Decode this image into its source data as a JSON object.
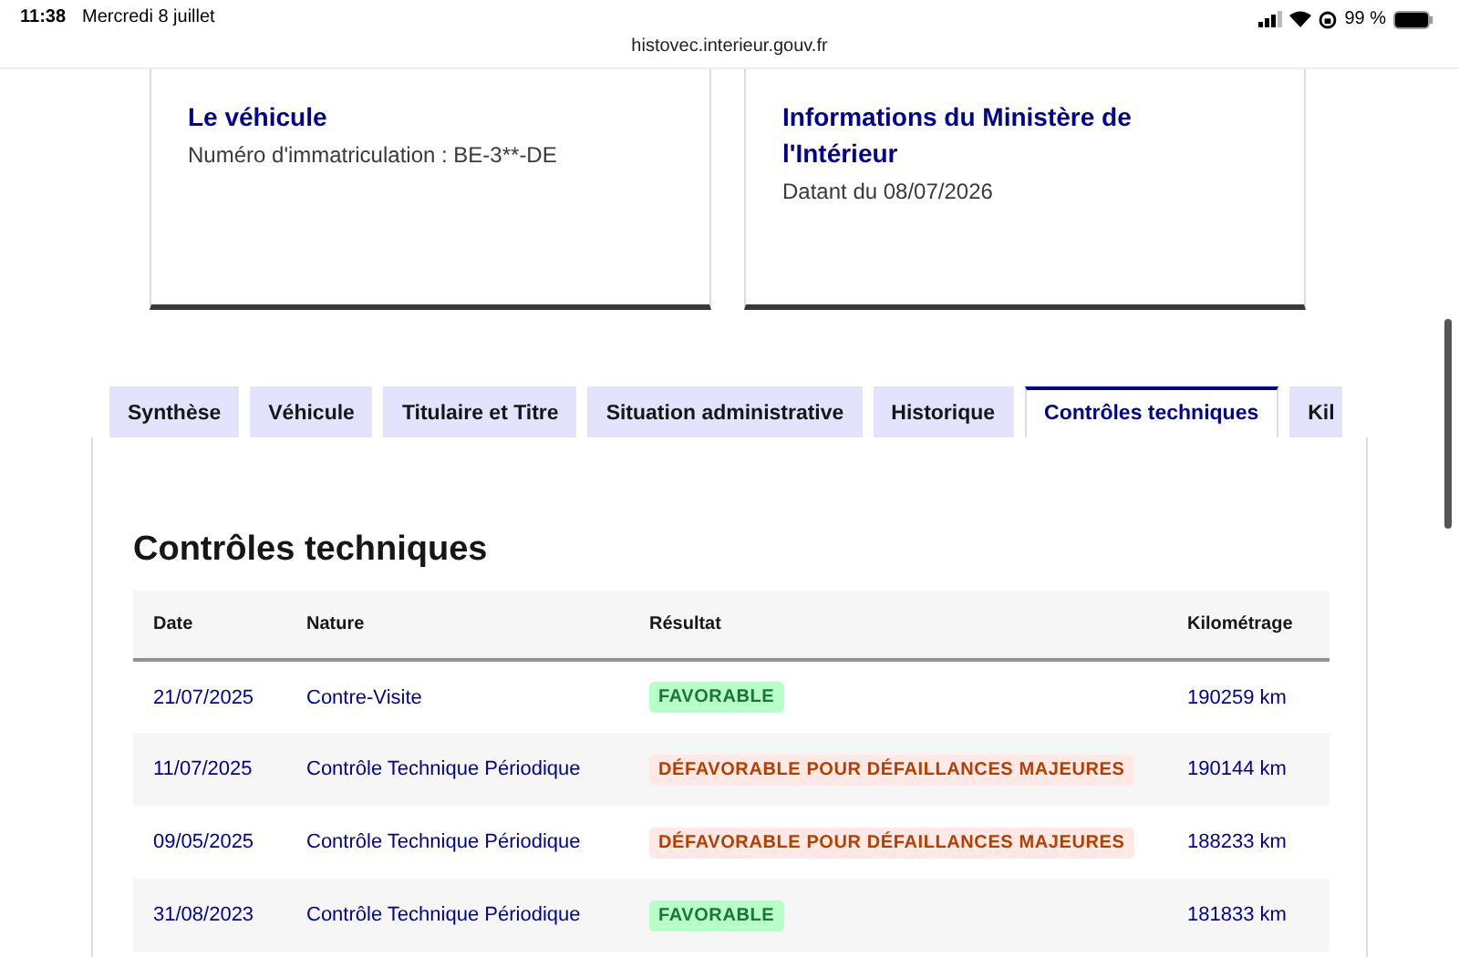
{
  "status_bar": {
    "time": "11:38",
    "date": "Mercredi 8 juillet",
    "battery": "99 %",
    "url": "histovec.interieur.gouv.fr"
  },
  "cards": [
    {
      "title": "Le véhicule",
      "text": "Numéro d'immatriculation : BE-3**-DE"
    },
    {
      "title": "Informations du Ministère de l'Intérieur",
      "text": "Datant du 08/07/2026"
    }
  ],
  "tabs": [
    {
      "label": "Synthèse",
      "selected": false
    },
    {
      "label": "Véhicule",
      "selected": false
    },
    {
      "label": "Titulaire et Titre",
      "selected": false
    },
    {
      "label": "Situation administrative",
      "selected": false
    },
    {
      "label": "Historique",
      "selected": false
    },
    {
      "label": "Contrôles techniques",
      "selected": true
    },
    {
      "label": "Kil",
      "selected": false
    }
  ],
  "section_title": "Contrôles techniques",
  "table": {
    "columns": [
      "Date",
      "Nature",
      "Résultat",
      "Kilométrage"
    ],
    "rows": [
      {
        "date": "21/07/2025",
        "nature": "Contre-Visite",
        "result": {
          "label": "FAVORABLE",
          "kind": "success"
        },
        "km": "190259 km"
      },
      {
        "date": "11/07/2025",
        "nature": "Contrôle Technique Périodique",
        "result": {
          "label": "DÉFAVORABLE POUR DÉFAILLANCES MAJEURES",
          "kind": "error"
        },
        "km": "190144 km"
      },
      {
        "date": "09/05/2025",
        "nature": "Contrôle Technique Périodique",
        "result": {
          "label": "DÉFAVORABLE POUR DÉFAILLANCES MAJEURES",
          "kind": "error"
        },
        "km": "188233 km"
      },
      {
        "date": "31/08/2023",
        "nature": "Contrôle Technique Périodique",
        "result": {
          "label": "FAVORABLE",
          "kind": "success"
        },
        "km": "181833 km"
      }
    ]
  }
}
